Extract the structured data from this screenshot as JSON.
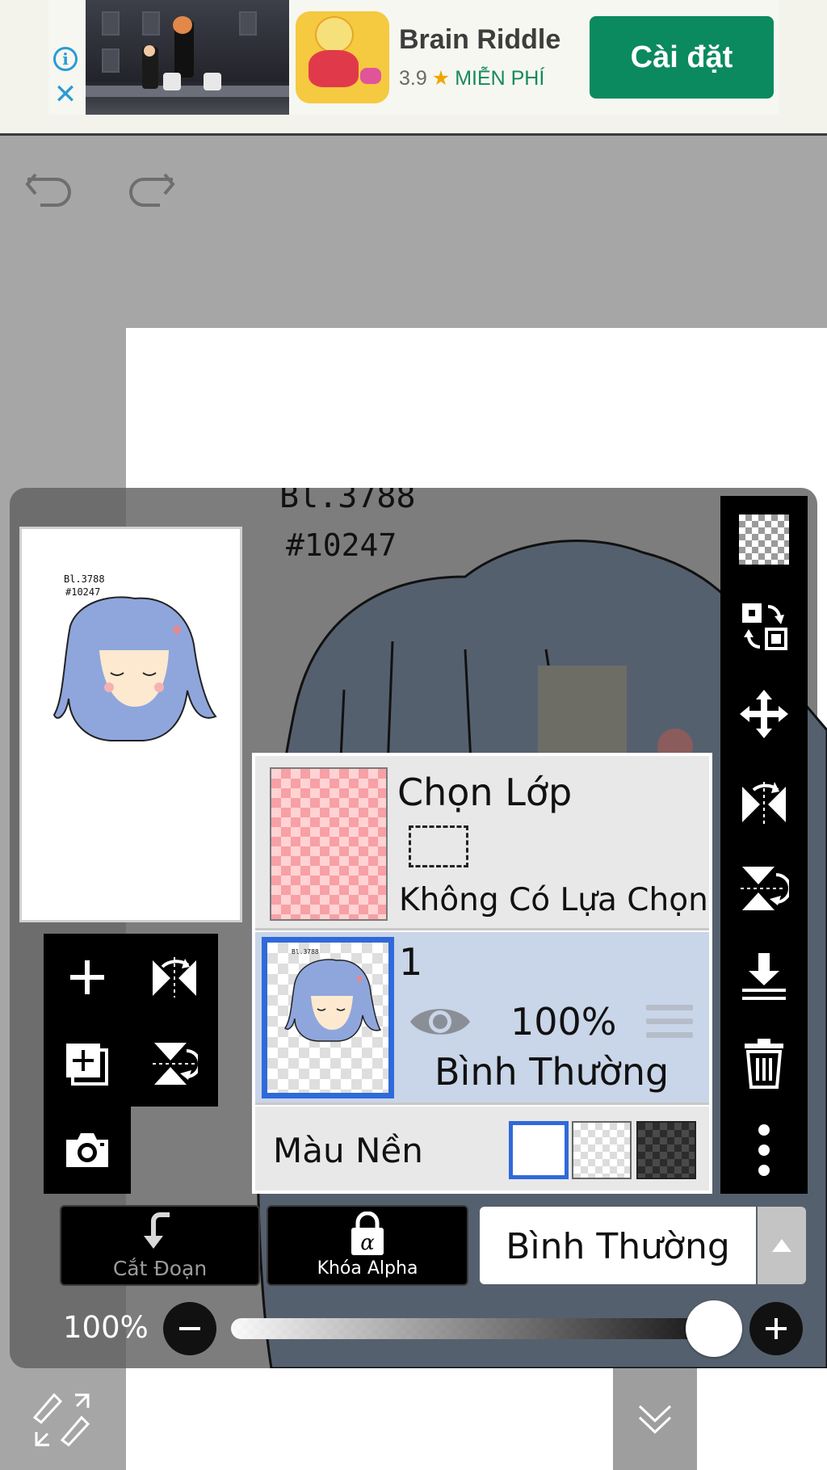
{
  "ad": {
    "title": "Brain Riddle",
    "rating": "3.9",
    "price": "MIỄN PHÍ",
    "install_label": "Cài đặt",
    "info_icon": "info-icon",
    "close_icon": "close-icon"
  },
  "toolbar": {
    "undo_icon": "undo-icon",
    "redo_icon": "redo-icon"
  },
  "preview": {
    "caption_line1": "Bl.3788",
    "caption_line2": "#10247"
  },
  "canvas": {
    "caption_line1": "Bl.3788",
    "caption_line2": "#10247"
  },
  "left_tools": [
    "add-layer-icon",
    "flip-horizontal-icon",
    "duplicate-layer-icon",
    "flip-vertical-icon",
    "camera-icon"
  ],
  "right_tools": [
    "transparent-checker-icon",
    "select-layer-transform-icon",
    "move-icon",
    "flip-layer-horizontal-icon",
    "flip-layer-vertical-icon",
    "merge-down-icon",
    "trash-icon",
    "more-icon"
  ],
  "selection_layer": {
    "title": "Chọn Lớp",
    "status": "Không Có Lựa Chọn"
  },
  "layer": {
    "name": "1",
    "opacity": "100%",
    "blend_mode": "Bình Thường"
  },
  "background": {
    "label": "Màu Nền",
    "selected": "white"
  },
  "controls": {
    "clipping_label": "Cắt Đoạn",
    "alpha_lock_label": "Khóa Alpha",
    "blend_mode": "Bình Thường",
    "opacity_label": "100%",
    "opacity_value": 1.0
  },
  "bottom_tools": [
    "transform-tool-icon",
    "brush-icon",
    "circle-icon",
    "square-icon",
    "arrow-up-icon",
    "chevron-down-double-icon",
    "back-arrow-icon"
  ],
  "bottom_active_index": 5,
  "colors": {
    "accent_blue": "#2f6ad9",
    "install_green": "#0b8a5f",
    "layer_selected_bg": "#c9d5e8",
    "hair_blue": "#8fa6dc"
  }
}
